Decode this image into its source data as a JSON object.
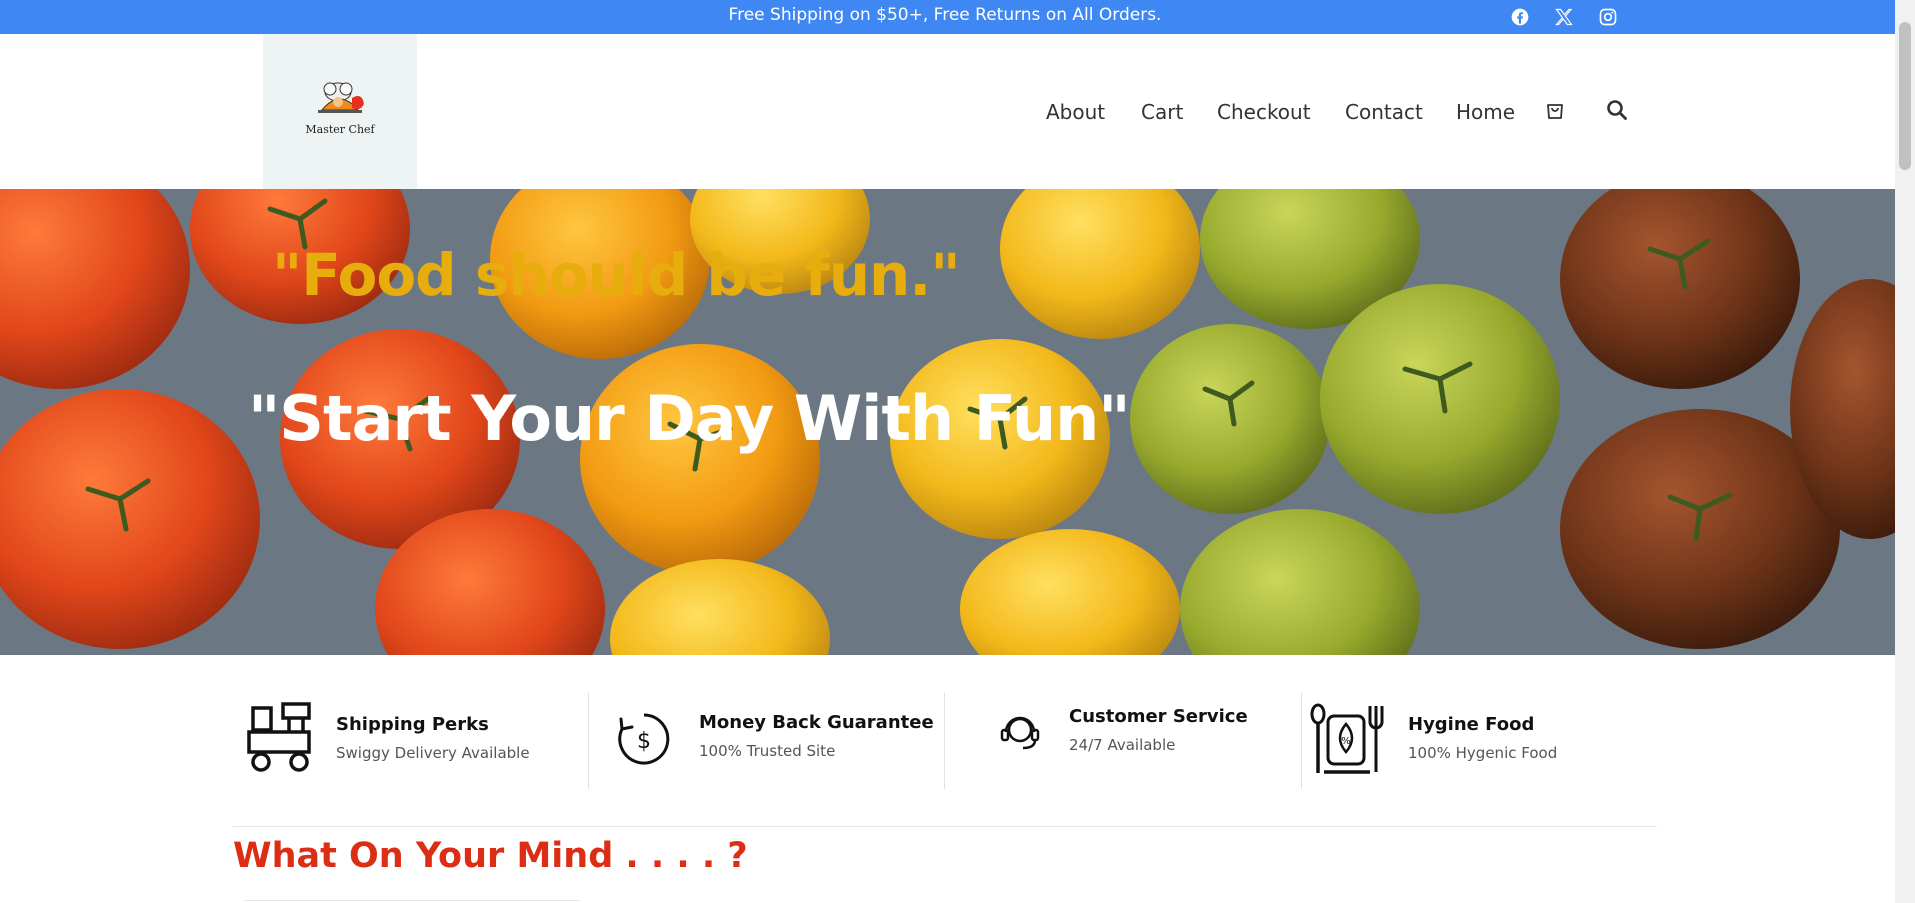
{
  "topbar": {
    "promo_text": "Free Shipping on $50+, Free Returns on All Orders.",
    "background": "#3f87f2",
    "social_icons": [
      "facebook-icon",
      "x-icon",
      "instagram-icon"
    ]
  },
  "header": {
    "logo_text": "Master Chef",
    "nav": [
      "About",
      "Cart",
      "Checkout",
      "Contact",
      "Home"
    ],
    "icons": [
      "cart-icon",
      "search-icon"
    ]
  },
  "hero": {
    "quote": "\"Food should be fun.\"",
    "title": "\"Start Your Day With Fun\"",
    "quote_color": "#e6ad0c",
    "title_color": "#ffffff"
  },
  "features": [
    {
      "icon": "delivery-scooter-icon",
      "title": "Shipping Perks",
      "subtitle": "Swiggy Delivery Available"
    },
    {
      "icon": "money-back-icon",
      "title": "Money Back Guarantee",
      "subtitle": "100% Trusted Site"
    },
    {
      "icon": "customer-service-headset-icon",
      "title": "Customer Service",
      "subtitle": "24/7 Available"
    },
    {
      "icon": "hygiene-food-icon",
      "title": "Hygine Food",
      "subtitle": "100% Hygenic Food"
    }
  ],
  "section": {
    "title": "What On Your Mind . . . . ?",
    "title_color": "#dc2e14"
  }
}
